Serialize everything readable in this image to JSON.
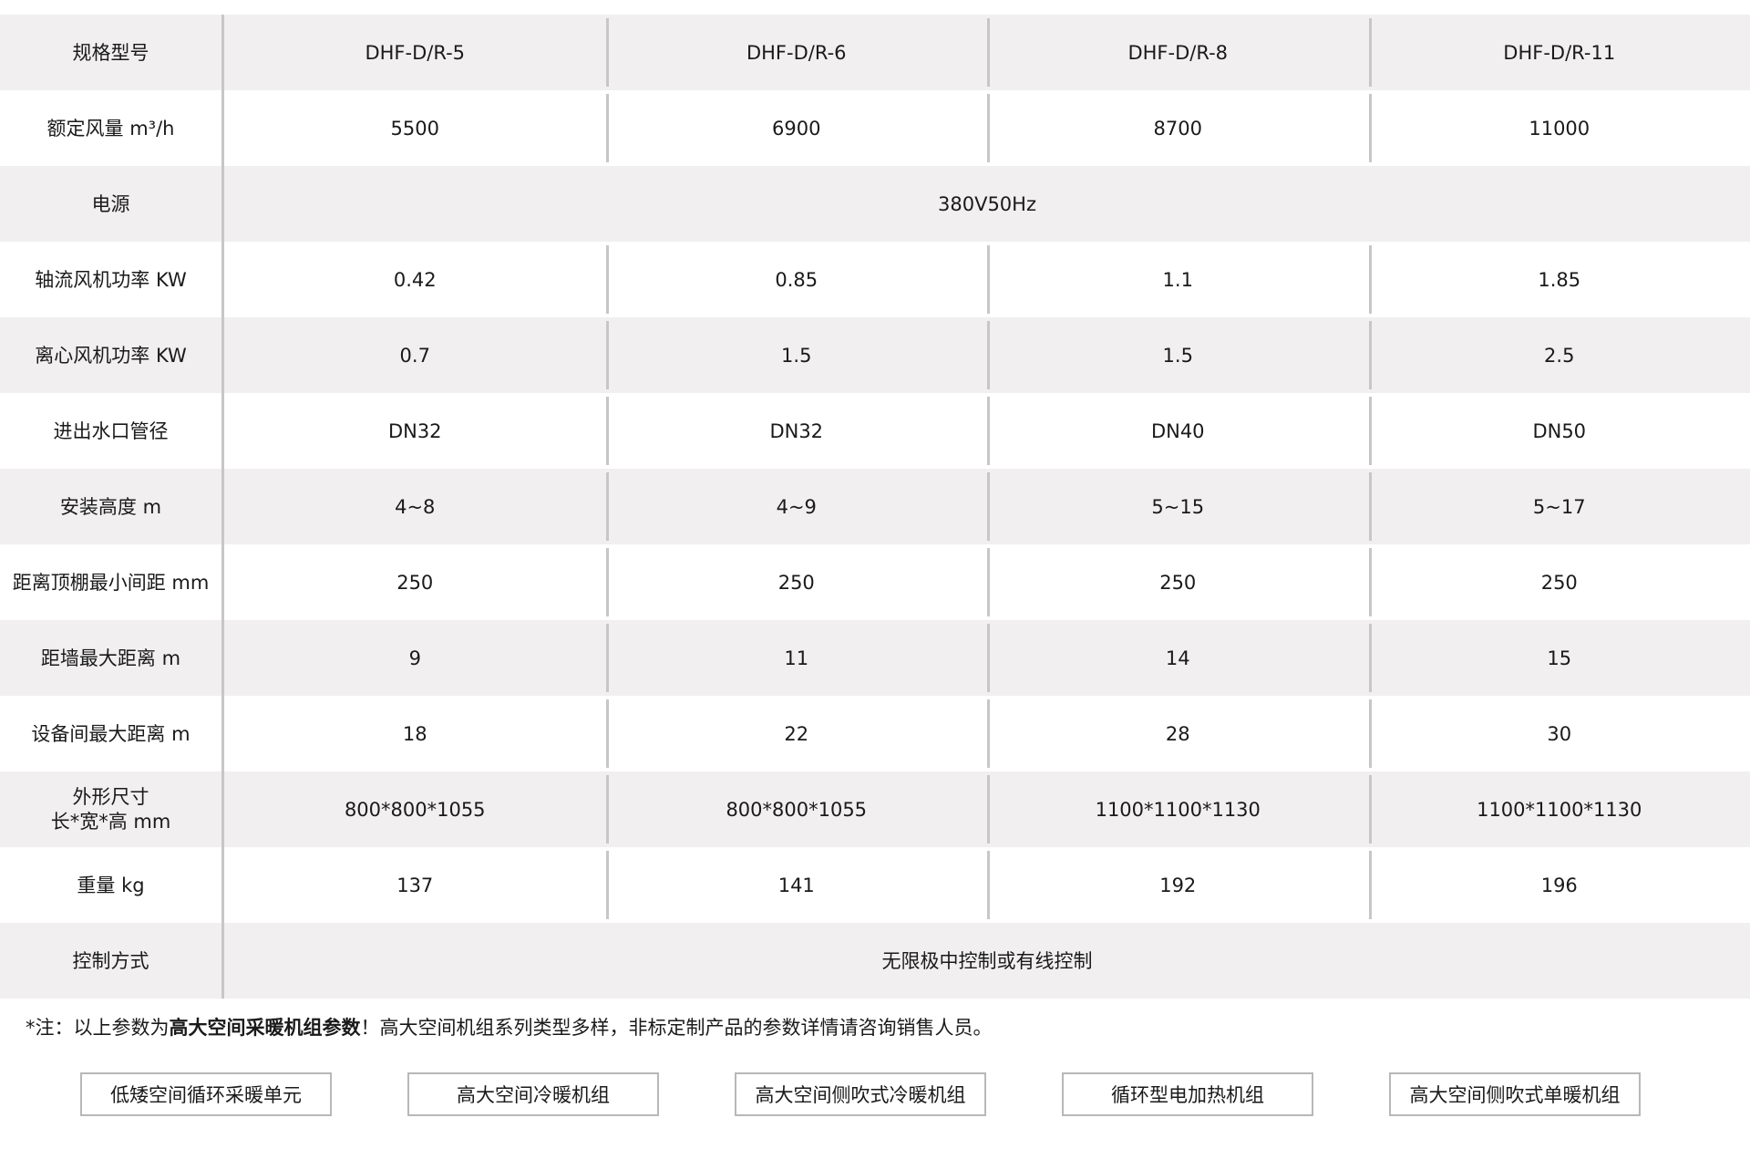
{
  "table": {
    "header": {
      "label": "规格型号",
      "models": [
        "DHF-D/R-5",
        "DHF-D/R-6",
        "DHF-D/R-8",
        "DHF-D/R-11"
      ]
    },
    "rows": [
      {
        "label": "额定风量 m³/h",
        "values": [
          "5500",
          "6900",
          "8700",
          "11000"
        ]
      },
      {
        "label": "电源",
        "merged": "380V50Hz"
      },
      {
        "label": "轴流风机功率 KW",
        "values": [
          "0.42",
          "0.85",
          "1.1",
          "1.85"
        ]
      },
      {
        "label": "离心风机功率 KW",
        "values": [
          "0.7",
          "1.5",
          "1.5",
          "2.5"
        ]
      },
      {
        "label": "进出水口管径",
        "values": [
          "DN32",
          "DN32",
          "DN40",
          "DN50"
        ]
      },
      {
        "label": "安装高度 m",
        "values": [
          "4~8",
          "4~9",
          "5~15",
          "5~17"
        ]
      },
      {
        "label": "距离顶棚最小间距 mm",
        "values": [
          "250",
          "250",
          "250",
          "250"
        ]
      },
      {
        "label": "距墙最大距离 m",
        "values": [
          "9",
          "11",
          "14",
          "15"
        ]
      },
      {
        "label": "设备间最大距离 m",
        "values": [
          "18",
          "22",
          "28",
          "30"
        ]
      },
      {
        "label_line1": "外形尺寸",
        "label_line2": "长*宽*高 mm",
        "values": [
          "800*800*1055",
          "800*800*1055",
          "1100*1100*1130",
          "1100*1100*1130"
        ]
      },
      {
        "label": "重量 kg",
        "values": [
          "137",
          "141",
          "192",
          "196"
        ]
      },
      {
        "label": "控制方式",
        "merged": "无限极中控制或有线控制"
      }
    ]
  },
  "note": {
    "prefix": "*注：以上参数为",
    "bold": "高大空间采暖机组参数",
    "suffix": "！高大空间机组系列类型多样，非标定制产品的参数详情请咨询销售人员。"
  },
  "buttons": [
    "低矮空间循环采暖单元",
    "高大空间冷暖机组",
    "高大空间侧吹式冷暖机组",
    "循环型电加热机组",
    "高大空间侧吹式单暖机组"
  ]
}
